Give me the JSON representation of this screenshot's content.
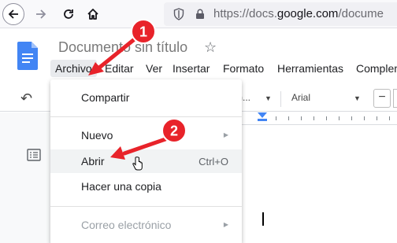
{
  "browser": {
    "url_prefix": "https://docs.",
    "url_domain": "google.com",
    "url_suffix": "/docume"
  },
  "doc": {
    "title": "Documento sin título"
  },
  "menubar": {
    "items": [
      "Archivo",
      "Editar",
      "Ver",
      "Insertar",
      "Formato",
      "Herramientas",
      "Complem"
    ],
    "active": "Archivo"
  },
  "toolbar": {
    "style_value": "rm...",
    "font_value": "Arial",
    "minus_label": "−"
  },
  "file_menu": {
    "items": [
      {
        "label": "Compartir"
      },
      {
        "label": "Nuevo",
        "submenu": true
      },
      {
        "label": "Abrir",
        "shortcut": "Ctrl+O",
        "hovered": true
      },
      {
        "label": "Hacer una copia"
      },
      {
        "label": "Correo electrónico",
        "submenu": true,
        "disabled": true
      }
    ]
  },
  "annotations": {
    "badge_1": "1",
    "badge_2": "2",
    "color": "#e8232a"
  },
  "colors": {
    "docs_blue": "#4285f4",
    "menu_hover": "#f1f3f4"
  }
}
